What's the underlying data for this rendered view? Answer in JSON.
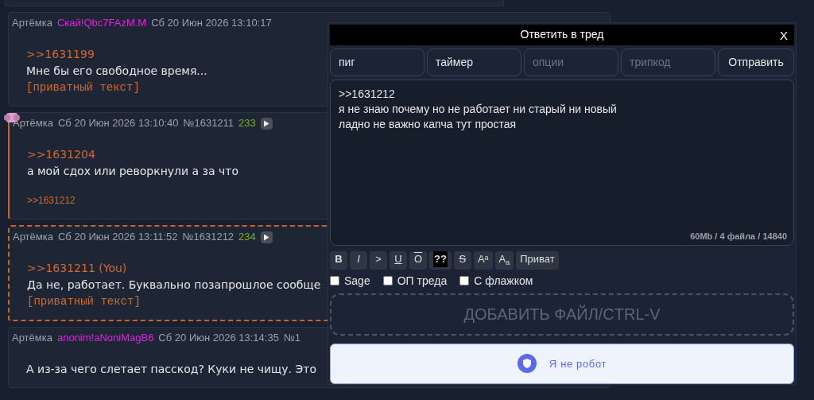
{
  "posts": [
    {
      "name": "Артёмка",
      "trip": "Скай!Qbc7FAzM.M",
      "date": "Сб 20 Июн 2026 13:10:17",
      "kind": "plain",
      "lines": [
        {
          "kind": "reply",
          "text": ">>1631199"
        },
        {
          "kind": "text",
          "text": "Мне бы его свободное время..."
        },
        {
          "kind": "private",
          "text": "[приватный текст]"
        }
      ],
      "sticker": false
    },
    {
      "name": "Артёмка",
      "date": "Сб 20 Июн 2026 13:10:40",
      "number": "№1631211",
      "count": "233",
      "kind": "replied",
      "lines": [
        {
          "kind": "reply",
          "text": ">>1631204"
        },
        {
          "kind": "text",
          "text": "а мой сдох или реворкнули а за что"
        }
      ],
      "backlinks": [
        ">>1631212"
      ],
      "sticker": true
    },
    {
      "name": "Артёмка",
      "date": "Сб 20 Июн 2026 13:11:52",
      "number": "№1631212",
      "count": "234",
      "kind": "own",
      "lines": [
        {
          "kind": "reply",
          "text": ">>1631211 (You)"
        },
        {
          "kind": "text",
          "text": "Да не, работает. Буквально позапрошлое сообще"
        },
        {
          "kind": "private",
          "text": "[приватный текст]"
        }
      ],
      "sticker": false
    },
    {
      "name": "Артёмка",
      "trip": "anonim!aNoniMagB6",
      "date": "Сб 20 Июн 2026 13:14:35",
      "number": "№1",
      "kind": "plain",
      "lines": [
        {
          "kind": "text",
          "text": "А из-за чего слетает пасскод? Куки не чищу. Это"
        }
      ],
      "sticker": false
    }
  ],
  "reply_form": {
    "title": "Ответить в тред",
    "close": "X",
    "fields": [
      {
        "value": "пиг"
      },
      {
        "value": "таймер"
      },
      {
        "placeholder": "опции"
      },
      {
        "placeholder": "трипкод"
      }
    ],
    "submit": "Отправить",
    "message": ">>1631212\nя не знаю почему но не работает ни старый ни новый\nладно не важно капча тут простая",
    "limits": "60Mb / 4 файла / 14840",
    "format_buttons": [
      {
        "kind": "bold",
        "label": "B"
      },
      {
        "kind": "italic",
        "label": "I"
      },
      {
        "kind": "plain",
        "label": ">"
      },
      {
        "kind": "underline",
        "label": "U"
      },
      {
        "kind": "overline",
        "label": "O"
      },
      {
        "kind": "spoiler",
        "label": "??"
      },
      {
        "kind": "strike",
        "label": "S"
      },
      {
        "kind": "sup",
        "label": "A",
        "small": "a"
      },
      {
        "kind": "sub",
        "label": "A",
        "small": "a"
      },
      {
        "kind": "plain",
        "label": "Приват"
      }
    ],
    "checkboxes": [
      {
        "label": "Sage",
        "checked": false
      },
      {
        "label": "ОП треда",
        "checked": false
      },
      {
        "label": "С флажком",
        "checked": false
      }
    ],
    "dropzone": "ДОБАВИТЬ ФАЙЛ/CTRL-V",
    "captcha": "Я не робот"
  }
}
